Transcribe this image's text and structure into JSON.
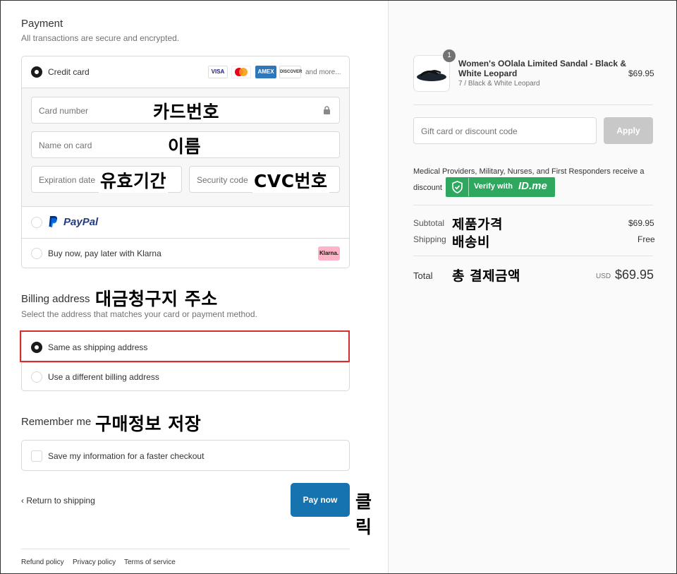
{
  "payment": {
    "title": "Payment",
    "subtitle": "All transactions are secure and encrypted.",
    "credit_card_label": "Credit card",
    "card_brands": [
      "VISA",
      "MC",
      "AMEX",
      "DISCOVER"
    ],
    "and_more": "and more...",
    "card_number_placeholder": "Card number",
    "name_placeholder": "Name on card",
    "expiration_placeholder": "Expiration date",
    "security_placeholder": "Security code",
    "paypal_label": "PayPal",
    "klarna_label": "Buy now, pay later with Klarna",
    "klarna_badge": "Klarna."
  },
  "annotations": {
    "card_number": "카드번호",
    "name": "이름",
    "expiration": "유효기간",
    "cvc": "CVC번호",
    "billing": "대금청구지 주소",
    "remember": "구매정보 저장",
    "click": "클릭",
    "product_price": "제품가격",
    "shipping_fee": "배송비",
    "total_amount": "총 결제금액"
  },
  "billing": {
    "title": "Billing address",
    "subtitle": "Select the address that matches your card or payment method.",
    "same_label": "Same as shipping address",
    "different_label": "Use a different billing address"
  },
  "remember": {
    "title": "Remember me",
    "save_label": "Save my information for a faster checkout"
  },
  "actions": {
    "return_label": "Return to shipping",
    "pay_label": "Pay now"
  },
  "footer": {
    "refund": "Refund policy",
    "privacy": "Privacy policy",
    "terms": "Terms of service"
  },
  "order": {
    "quantity": "1",
    "product_name_line1": "Women's OOlala Limited Sandal - Black &",
    "product_name_line2": "White Leopard",
    "variant": "7 / Black & White Leopard",
    "price": "$69.95",
    "discount_placeholder": "Gift card or discount code",
    "apply_label": "Apply",
    "medical_line1": "Medical Providers, Military, Nurses, and First Responders receive a",
    "medical_line2": "discount",
    "verify_label": "Verify with",
    "verify_brand": "ID.me",
    "subtotal_label": "Subtotal",
    "subtotal_value": "$69.95",
    "shipping_label": "Shipping",
    "shipping_value": "Free",
    "total_label": "Total",
    "currency": "USD",
    "total_value": "$69.95"
  },
  "colors": {
    "pay_button": "#1773b0",
    "highlight_border": "#d32f2f",
    "idme_green": "#2ea85f",
    "apply_button": "#c8c8c8"
  }
}
